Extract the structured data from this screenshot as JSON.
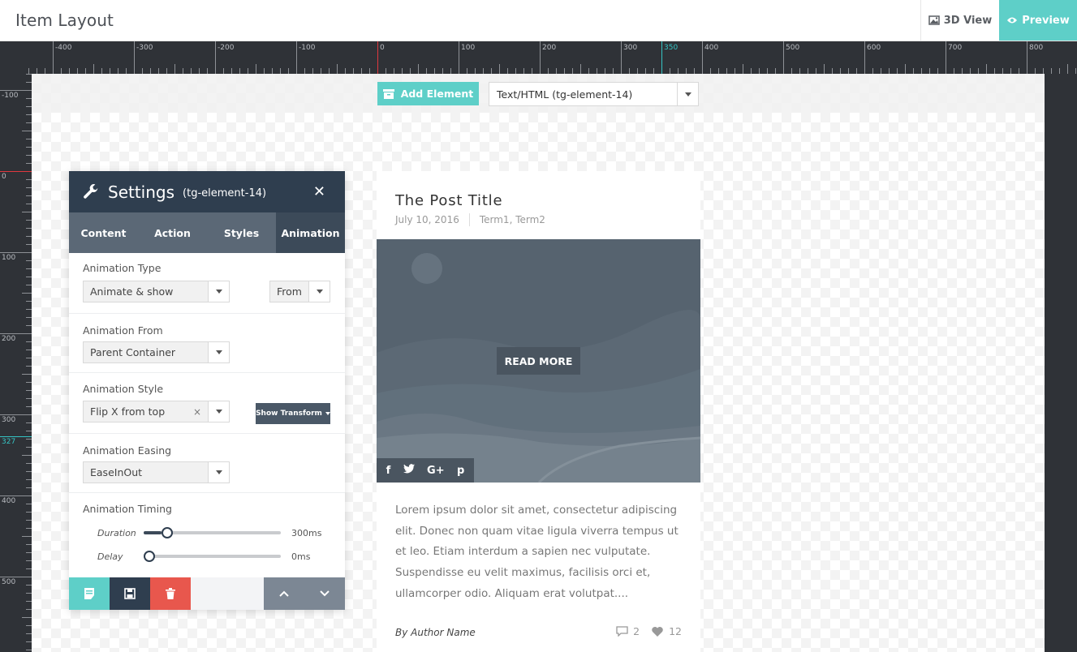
{
  "header": {
    "title": "Item Layout",
    "view3d_label": "3D View",
    "preview_label": "Preview"
  },
  "ruler": {
    "h_labels": [
      "-400",
      "-300",
      "-200",
      "-100",
      "0",
      "100",
      "200",
      "300",
      "350",
      "400",
      "500",
      "600",
      "700",
      "800"
    ],
    "v_labels": [
      "-100",
      "0",
      "100",
      "200",
      "300",
      "327",
      "400",
      "500"
    ]
  },
  "toolbar": {
    "add_element_label": "Add Element",
    "element_select_value": "Text/HTML (tg-element-14)"
  },
  "settings": {
    "title": "Settings",
    "element_id": "(tg-element-14)",
    "tabs": [
      {
        "label": "Content",
        "active": false
      },
      {
        "label": "Action",
        "active": false
      },
      {
        "label": "Styles",
        "active": false
      },
      {
        "label": "Animation",
        "active": true
      }
    ],
    "animation_type": {
      "label": "Animation Type",
      "value": "Animate & show",
      "direction": "From"
    },
    "animation_from": {
      "label": "Animation From",
      "value": "Parent Container"
    },
    "animation_style": {
      "label": "Animation Style",
      "value": "Flip X from top",
      "clear": "×",
      "transform_button": "Show Transform"
    },
    "animation_easing": {
      "label": "Animation Easing",
      "value": "EaseInOut"
    },
    "animation_timing": {
      "label": "Animation Timing",
      "duration": {
        "label": "Duration",
        "value": "300ms",
        "fraction": 0.13
      },
      "delay": {
        "label": "Delay",
        "value": "0ms",
        "fraction": 0.0
      }
    }
  },
  "post": {
    "title": "The Post Title",
    "date": "July 10, 2016",
    "terms": "Term1, Term2",
    "read_more": "READ MORE",
    "excerpt": "Lorem ipsum dolor sit amet, consectetur adipiscing elit. Donec non quam vitae ligula viverra tempus ut et leo. Etiam interdum a sapien nec vulputate. Suspendisse eu velit maximus, facilisis orci et, ullamcorper odio. Aliquam erat volutpat....",
    "author": "By Author Name",
    "comments": "2",
    "likes": "12",
    "social": [
      "f",
      "t",
      "G+",
      "p"
    ]
  },
  "colors": {
    "accent": "#5ecfc8",
    "panel_dark": "#2f3e4f",
    "delete": "#e8574d",
    "ruler_highlight": "#35c4c4",
    "ruler_zero": "#e0383e"
  }
}
